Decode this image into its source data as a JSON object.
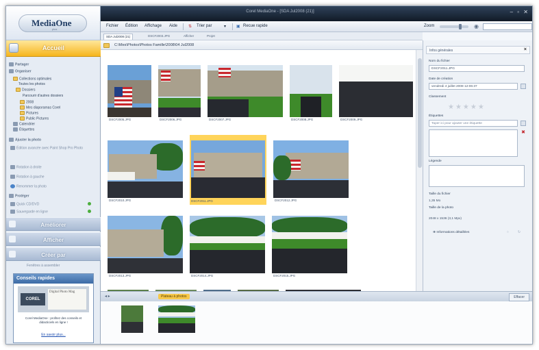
{
  "window": {
    "title": "Corel MediaOne - [SDA Jul2008 (21)]"
  },
  "brand": {
    "name": "MediaOne",
    "sub": "plus"
  },
  "menu": {
    "items": [
      "Fichier",
      "Édition",
      "Affichage",
      "Aide"
    ],
    "sort": "Trier par",
    "quick_search": "Recue rapide",
    "zoom": "Zoom"
  },
  "tabs": [
    "SDA Jul2008 (21)",
    "DSCF2003.JPG",
    "Afficher",
    "Projet"
  ],
  "path": "C:\\Mes\\Photos\\Photos Famille\\2008\\04 Jul2008",
  "left": {
    "home": "Accueil",
    "partager": "Partager",
    "organiser": "Organiser",
    "tree": [
      "Collections optimales",
      "Toutes les photos",
      "Dossiers",
      "Parcourir d'autres dossiers",
      "2008",
      "Mes diaporamas Corel",
      "Pictures",
      "Public Pictures",
      "Calendrier",
      "Étiquettes"
    ],
    "ajuster": "Ajuster la photo",
    "actions": [
      "Édition avancée avec Paint Shop Pro Photo",
      "Rotation à droite",
      "Rotation à gauche",
      "Renommer la photo"
    ],
    "proteger": "Protéger",
    "protect_items": [
      "Quick CD/DVD",
      "Sauvegarde en ligne"
    ],
    "big_buttons": [
      "Améliorer",
      "Afficher",
      "Créer par"
    ],
    "footer_link": "Fenêtres à assembler",
    "tips": {
      "title": "Conseils rapides",
      "brand": "COREL",
      "paper": "Digital Photo Mag",
      "text": "Corel MediaOne : profitez des conseils et didacticiels en ligne !",
      "link": "En savoir plus..."
    }
  },
  "photos": [
    "DSCF2005.JPG",
    "DSCF2006.JPG",
    "DSCF2007.JPG",
    "DSCF2008.JPG",
    "DSCF2009.JPG",
    "DSCF2010.JPG",
    "DSCF2011.JPG",
    "DSCF2012.JPG",
    "DSCF2013.JPG",
    "DSCF2014.JPG",
    "DSCF2015.JPG"
  ],
  "tray": {
    "badge": "Plateau à photos",
    "clear": "Effacer"
  },
  "info": {
    "header": "Infos générales",
    "filename_label": "Nom du fichier",
    "filename": "DSCF2011.JPG",
    "date_label": "Date de création",
    "date": "vendredi 4 juillet 2008 12:06:37",
    "rating_label": "Classement",
    "tags_label": "Étiquettes",
    "tags_placeholder": "Taper ici pour ajouter une étiquette",
    "caption_label": "Légende",
    "size_label": "Taille du fichier",
    "size": "1,35 Mo",
    "dims_label": "Taille de la photo",
    "dims": "2048 x 1536 (3,1 Mpx)",
    "details": "Informations détaillées"
  }
}
